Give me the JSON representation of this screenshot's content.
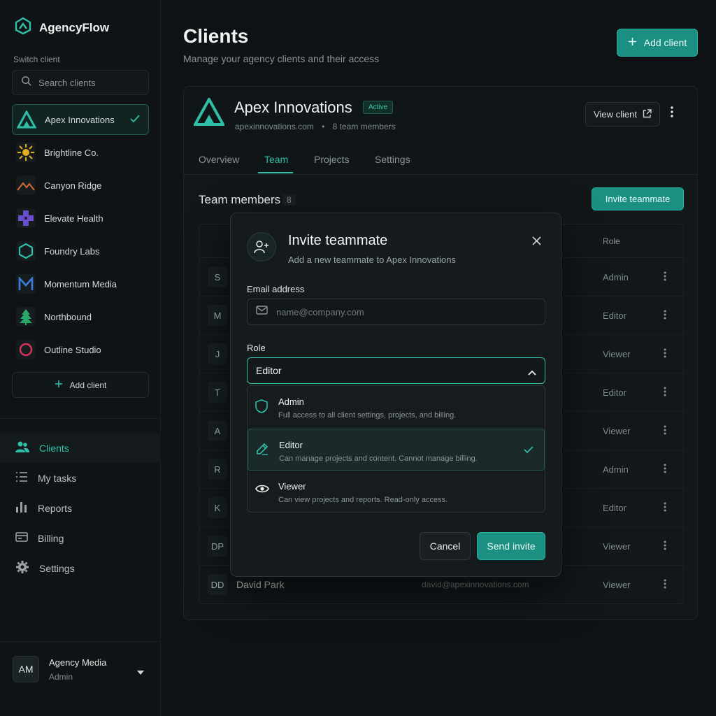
{
  "brand": {
    "name": "AgencyFlow"
  },
  "sidebar": {
    "switch_label": "Switch client",
    "search_placeholder": "Search clients",
    "clients": [
      {
        "name": "Apex Innovations",
        "icon": "apex-logo-icon",
        "active": true
      },
      {
        "name": "Brightline Co.",
        "icon": "sun-logo-icon"
      },
      {
        "name": "Canyon Ridge",
        "icon": "mountain-logo-icon"
      },
      {
        "name": "Elevate Health",
        "icon": "cross-logo-icon"
      },
      {
        "name": "Foundry Labs",
        "icon": "hexagon-logo-icon"
      },
      {
        "name": "Momentum Media",
        "icon": "m-logo-icon"
      },
      {
        "name": "Northbound",
        "icon": "tree-logo-icon"
      },
      {
        "name": "Outline Studio",
        "icon": "ring-logo-icon"
      }
    ],
    "add_client_label": "Add client",
    "nav": [
      {
        "label": "Clients",
        "icon": "users-icon",
        "active": true
      },
      {
        "label": "My tasks",
        "icon": "list-icon"
      },
      {
        "label": "Reports",
        "icon": "bar-chart-icon"
      },
      {
        "label": "Billing",
        "icon": "card-icon"
      },
      {
        "label": "Settings",
        "icon": "gear-icon"
      }
    ],
    "user": {
      "initials": "AM",
      "name": "Agency Media",
      "role": "Admin"
    }
  },
  "header": {
    "title": "Clients",
    "subtitle": "Manage your agency clients and their access",
    "add_client_label": "Add client"
  },
  "client": {
    "name": "Apex Innovations",
    "status": "Active",
    "domain": "apexinnovations.com",
    "separator": "•",
    "members": "8 team members",
    "view_label": "View client",
    "tabs": [
      "Overview",
      "Team",
      "Projects",
      "Settings"
    ],
    "active_tab": "Team"
  },
  "team": {
    "title": "Team members",
    "count": "8",
    "invite_label": "Invite teammate",
    "role_header": "Role",
    "rows": [
      {
        "initials": "S",
        "name": "",
        "email": "",
        "role": "Admin"
      },
      {
        "initials": "M",
        "name": "",
        "email": "",
        "role": "Editor"
      },
      {
        "initials": "J",
        "name": "",
        "email": "",
        "role": "Viewer"
      },
      {
        "initials": "T",
        "name": "",
        "email": "",
        "role": "Editor"
      },
      {
        "initials": "A",
        "name": "",
        "email": "",
        "role": "Viewer"
      },
      {
        "initials": "R",
        "name": "",
        "email": "",
        "role": "Admin"
      },
      {
        "initials": "K",
        "name": "",
        "email": "",
        "role": "Editor"
      },
      {
        "initials": "DP",
        "name": "",
        "email": "",
        "role": "Viewer"
      },
      {
        "initials": "DD",
        "name": "David Park",
        "email": "david@apexinnovations.com",
        "role": "Viewer"
      }
    ]
  },
  "modal": {
    "title": "Invite teammate",
    "subtitle": "Add a new teammate to Apex Innovations",
    "email_label": "Email address",
    "email_placeholder": "name@company.com",
    "email_value": "",
    "role_label": "Role",
    "role_value": "Editor",
    "options": [
      {
        "title": "Admin",
        "desc": "Full access to all client settings, projects, and billing.",
        "icon": "shield-icon"
      },
      {
        "title": "Editor",
        "desc": "Can manage projects and content. Cannot manage billing.",
        "icon": "pencil-icon",
        "selected": true
      },
      {
        "title": "Viewer",
        "desc": "Can view projects and reports. Read-only access.",
        "icon": "eye-icon"
      }
    ],
    "cancel_label": "Cancel",
    "send_label": "Send invite"
  },
  "colors": {
    "accent": "#2fbfa9",
    "primary_button": "#1a8f82",
    "background": "#0e1214"
  }
}
